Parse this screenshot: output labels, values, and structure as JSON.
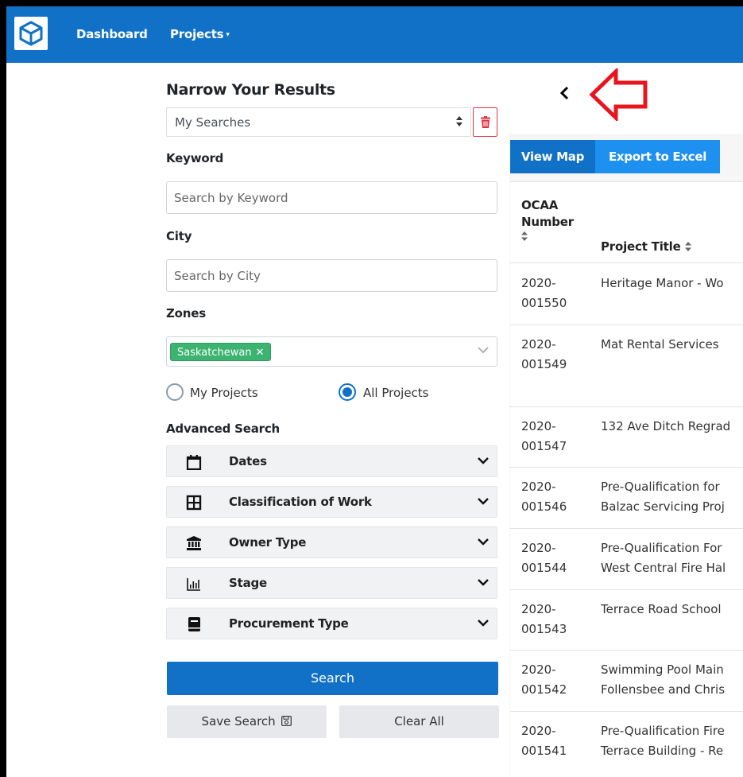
{
  "nav": {
    "dashboard": "Dashboard",
    "projects": "Projects",
    "caret": "▾"
  },
  "filters": {
    "heading": "Narrow Your Results",
    "my_searches": "My Searches",
    "keyword_label": "Keyword",
    "keyword_placeholder": "Search by Keyword",
    "city_label": "City",
    "city_placeholder": "Search by City",
    "zones_label": "Zones",
    "zone_tag": "Saskatchewan",
    "zone_tag_remove": "✕",
    "radio_my_projects": "My Projects",
    "radio_all_projects": "All Projects",
    "advanced_label": "Advanced Search",
    "accordions": [
      {
        "label": "Dates",
        "icon": "calendar-icon"
      },
      {
        "label": "Classification of Work",
        "icon": "grid-icon"
      },
      {
        "label": "Owner Type",
        "icon": "bank-icon"
      },
      {
        "label": "Stage",
        "icon": "bar-chart-icon"
      },
      {
        "label": "Procurement Type",
        "icon": "book-icon"
      }
    ],
    "search_button": "Search",
    "save_search_button": "Save Search",
    "clear_all_button": "Clear All"
  },
  "results": {
    "view_map": "View Map",
    "export_excel": "Export to Excel",
    "col_number": "OCAA Number",
    "col_number_line1": "OCAA",
    "col_number_line2": "Number",
    "col_title": "Project Title",
    "rows": [
      {
        "year": "2020-",
        "num": "001550",
        "title1": "Heritage Manor - Wo",
        "title2": ""
      },
      {
        "year": "2020-",
        "num": "001549",
        "title1": "Mat Rental Services",
        "title2": ""
      },
      {
        "year": "2020-",
        "num": "001547",
        "title1": "132 Ave Ditch Regrad",
        "title2": ""
      },
      {
        "year": "2020-",
        "num": "001546",
        "title1": "Pre-Qualification for",
        "title2": "Balzac Servicing Proj"
      },
      {
        "year": "2020-",
        "num": "001544",
        "title1": "Pre-Qualification For",
        "title2": "West Central Fire Hal"
      },
      {
        "year": "2020-",
        "num": "001543",
        "title1": "Terrace Road School",
        "title2": ""
      },
      {
        "year": "2020-",
        "num": "001542",
        "title1": "Swimming Pool Main",
        "title2": "Follensbee and Chris"
      },
      {
        "year": "2020-",
        "num": "001541",
        "title1": "Pre-Qualification Fire",
        "title2": "Terrace Building - Re"
      }
    ]
  },
  "colors": {
    "primary": "#1171c6",
    "export": "#1e90f0",
    "zone_tag": "#3cb371",
    "danger": "#dc3545",
    "annotation_arrow": "#e8141e"
  }
}
